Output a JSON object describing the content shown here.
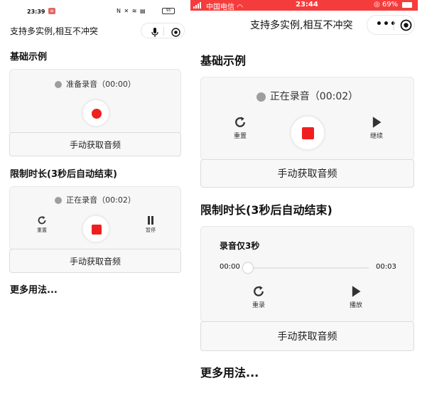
{
  "left": {
    "status_bar": {
      "time": "23:39",
      "notification_badge": "≡",
      "icons": "N ✕ ≋ ▤",
      "battery": "93"
    },
    "nav": {
      "title": "支持多实例,相互不冲突",
      "capsule_icons": [
        "mic-icon",
        "target-icon"
      ]
    },
    "basic": {
      "section_title": "基础示例",
      "status": "准备录音（00:00）",
      "get_audio_button": "手动获取音频"
    },
    "limited": {
      "section_title": "限制时长(3秒后自动结束)",
      "status": "正在录音（00:02）",
      "reset_label": "重置",
      "pause_label": "暂停",
      "get_audio_button": "手动获取音频"
    },
    "more_usage": "更多用法..."
  },
  "right": {
    "status_bar": {
      "carrier": "中国电信",
      "time": "23:44",
      "battery": "69%"
    },
    "nav": {
      "title": "支持多实例,相互不冲突",
      "capsule_icons": [
        "more-icon",
        "target-icon"
      ]
    },
    "basic": {
      "section_title": "基础示例",
      "status": "正在录音（00:02）",
      "reset_label": "重置",
      "continue_label": "继续",
      "get_audio_button": "手动获取音频"
    },
    "limited": {
      "section_title": "限制时长(3秒后自动结束)",
      "recorded_title": "录音仅3秒",
      "time_current": "00:00",
      "time_total": "00:03",
      "playback_progress": 0,
      "rerecord_label": "重录",
      "play_label": "播放",
      "get_audio_button": "手动获取音频"
    },
    "more_usage": "更多用法..."
  },
  "colors": {
    "record_red": "#f01f1f",
    "status_bar_red": "#f53c3c",
    "card_bg": "#f7f7f7",
    "status_dot": "#9e9e9e"
  }
}
